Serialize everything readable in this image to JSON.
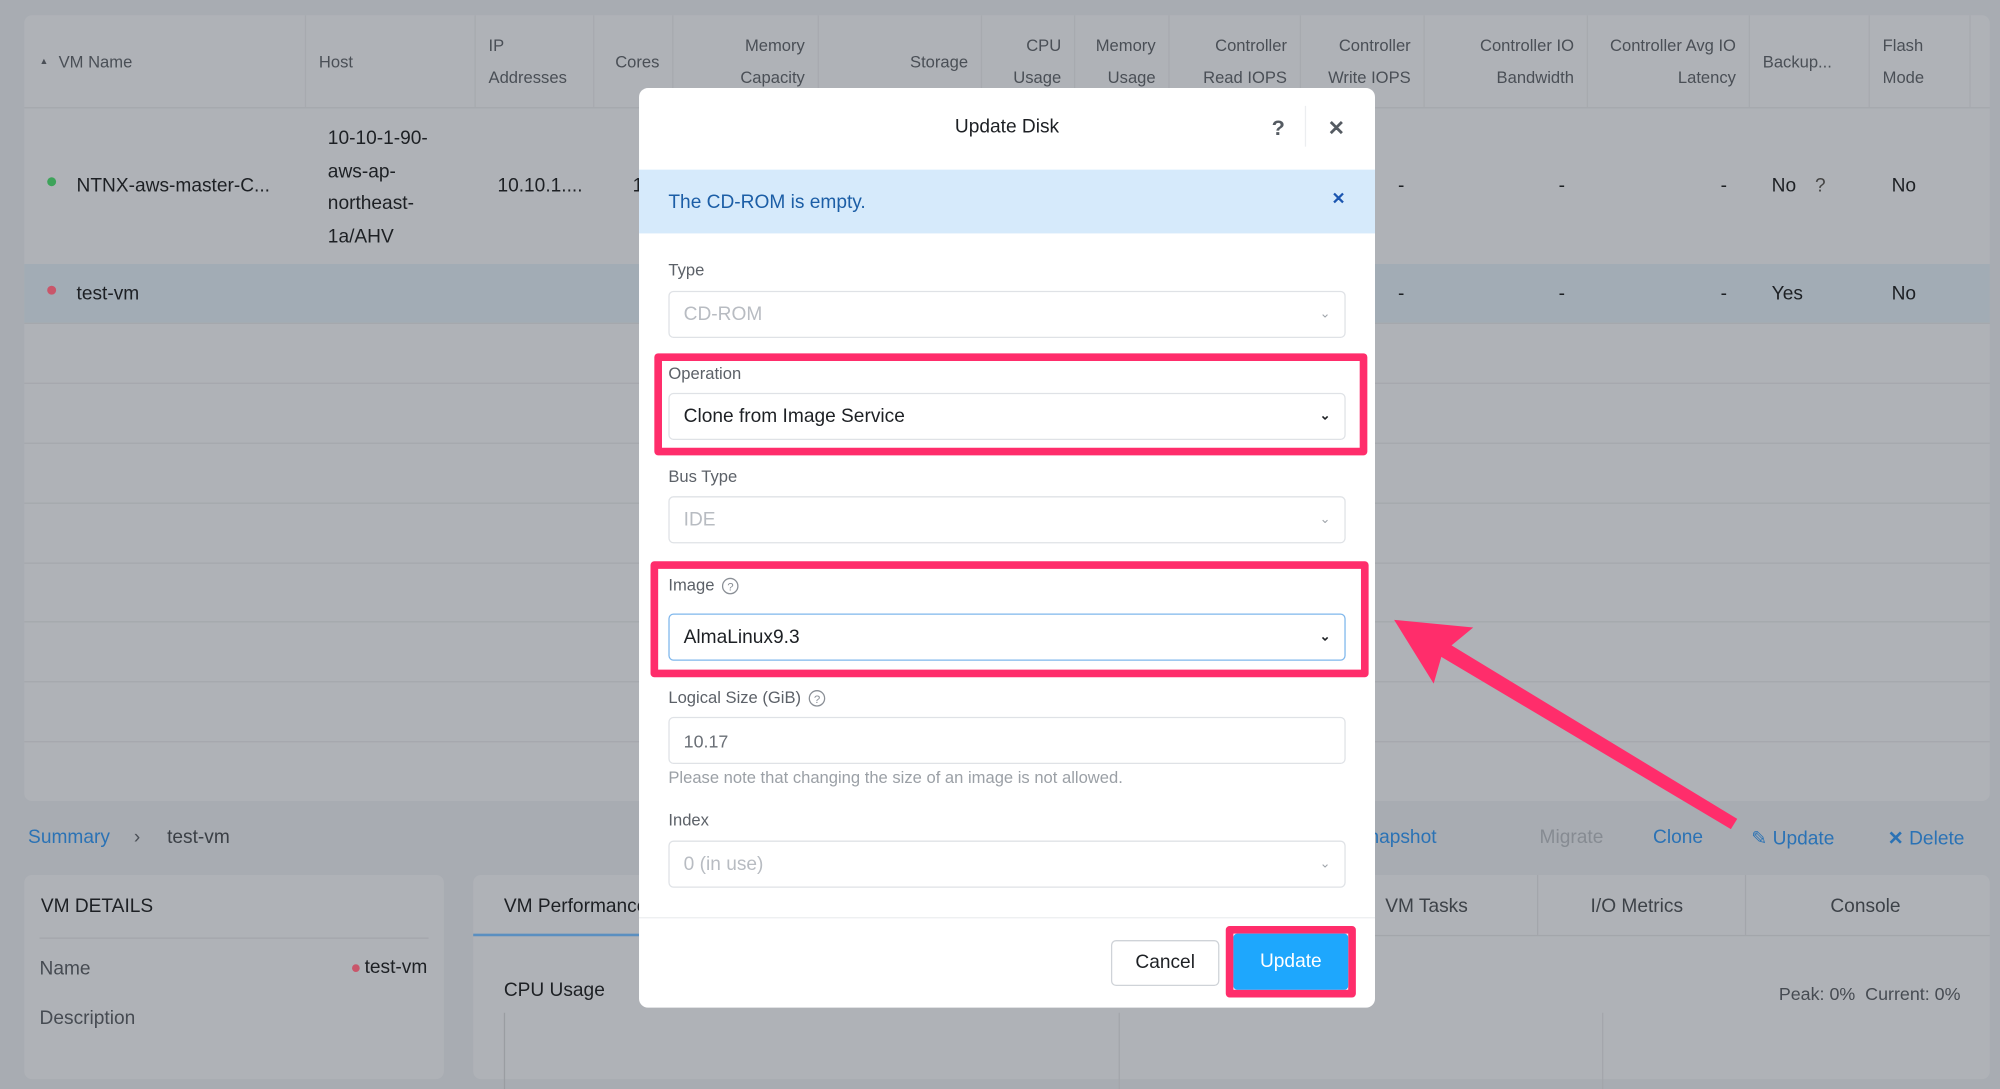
{
  "table": {
    "columns": [
      "VM Name",
      "Host",
      "IP Addresses",
      "Cores",
      "Memory Capacity",
      "Storage",
      "CPU Usage",
      "Memory Usage",
      "Controller Read IOPS",
      "Controller Write IOPS",
      "Controller IO Bandwidth",
      "Controller Avg IO Latency",
      "Backup...",
      "Flash Mode"
    ],
    "column_lines": [
      [
        "VM Name"
      ],
      [
        "Host"
      ],
      [
        "IP",
        "Addresses"
      ],
      [
        "Cores"
      ],
      [
        "Memory",
        "Capacity"
      ],
      [
        "Storage"
      ],
      [
        "CPU",
        "Usage"
      ],
      [
        "Memory",
        "Usage"
      ],
      [
        "Controller",
        "Read IOPS"
      ],
      [
        "Controller",
        "Write IOPS"
      ],
      [
        "Controller IO",
        "Bandwidth"
      ],
      [
        "Controller Avg IO",
        "Latency"
      ],
      [
        "Backup..."
      ],
      [
        "Flash",
        "Mode"
      ]
    ],
    "rows": [
      {
        "status_color": "#3da35a",
        "name": "NTNX-aws-master-C...",
        "host": "10-10-1-90-aws-ap-northeast-1a/AHV",
        "host_lines": [
          "10-10-1-90-",
          "aws-ap-",
          "northeast-",
          "1a/AHV"
        ],
        "ip": "10.10.1....",
        "cores": "1",
        "write_iops": "-",
        "io_bandwidth": "-",
        "avg_latency": "-",
        "backup": "No",
        "backup_help": "?",
        "flash_mode": "No"
      },
      {
        "status_color": "#c9566a",
        "name": "test-vm",
        "write_iops": "-",
        "io_bandwidth": "-",
        "avg_latency": "-",
        "backup": "Yes",
        "flash_mode": "No",
        "selected": true
      }
    ]
  },
  "breadcrumb": {
    "root": "Summary",
    "separator": "›",
    "current": "test-vm"
  },
  "actions": {
    "snapshot": "Take Snapshot",
    "migrate": "Migrate",
    "clone": "Clone",
    "update": "Update",
    "delete": "Delete"
  },
  "vm_details": {
    "title": "VM DETAILS",
    "name_label": "Name",
    "name_value": "test-vm",
    "description_label": "Description"
  },
  "performance": {
    "tabs": [
      "VM Performance",
      "VM Tasks",
      "I/O Metrics",
      "Console"
    ],
    "cpu_title": "CPU Usage",
    "peak": "Peak: 0%  Current: 0%"
  },
  "modal": {
    "title": "Update Disk",
    "help": "?",
    "close": "✕",
    "alert": "The CD-ROM is empty.",
    "alert_close": "✕",
    "type_label": "Type",
    "type_value": "CD-ROM",
    "operation_label": "Operation",
    "operation_value": "Clone from Image Service",
    "bus_label": "Bus Type",
    "bus_value": "IDE",
    "image_label": "Image",
    "image_value": "AlmaLinux9.3",
    "size_label": "Logical Size (GiB)",
    "size_value": "10.17",
    "size_note": "Please note that changing the size of an image is not allowed.",
    "index_label": "Index",
    "index_value": "0 (in use)",
    "cancel": "Cancel",
    "update": "Update"
  },
  "colors": {
    "highlight": "#ff2d6b",
    "primary": "#1ea7fd",
    "link": "#2a72b5",
    "alert_bg": "#d6eafb"
  }
}
